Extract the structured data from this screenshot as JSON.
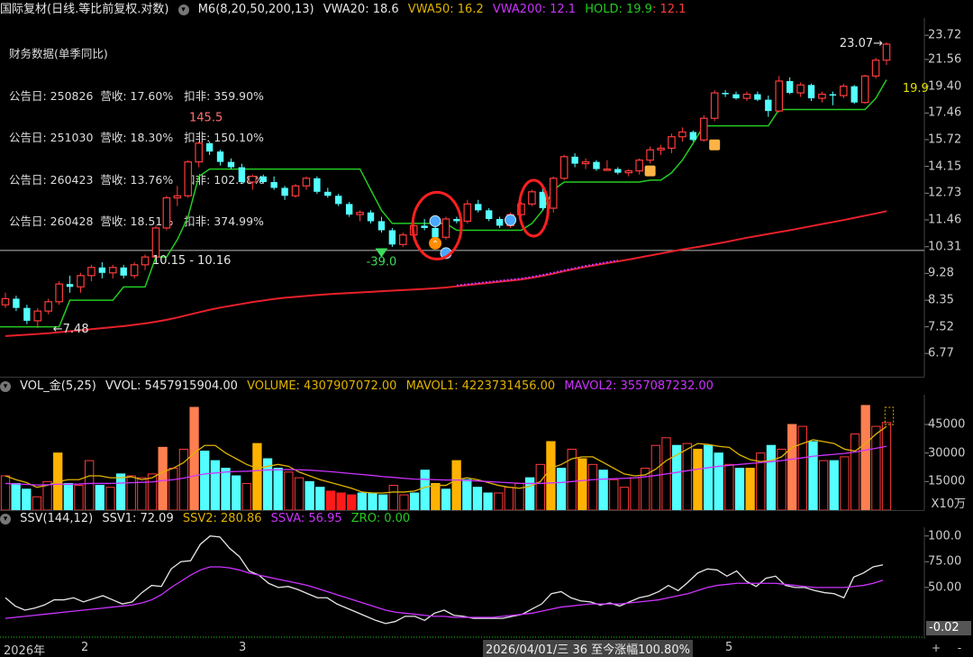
{
  "header": {
    "title": "国际复材(日线.等比前复权.对数)",
    "toggle_icon": "chevron-down-circle-icon",
    "ma_label": "M6(8,20,50,200,13)",
    "vwa20": "VWA20: 18.6",
    "vwa50": "VWA50: 16.2",
    "vwa200": "VWA200: 12.1",
    "hold1": "HOLD: 19.9",
    "hold2": ": 12.1"
  },
  "financials": {
    "title": "财务数据(单季同比)",
    "rows": [
      "公告日: 250826  营收: 17.60%   扣非: 359.90%",
      "公告日: 251030  营收: 18.30%   扣非: 150.10%",
      "公告日: 260423  营收: 13.76%   扣非: 102.98%",
      "公告日: 260428  营收: 18.51%   扣非: 374.99%"
    ]
  },
  "annotations": {
    "high": "145.5",
    "low": "7.48",
    "range": "10.15 - 10.16",
    "last_high": "23.07",
    "hold_value": "19.9",
    "signal": "-39.0"
  },
  "vol_header": {
    "name": "VOL_金(5,25)",
    "vvol": "VVOL: 5457915904.00",
    "volume": "VOLUME: 4307907072.00",
    "mavol1": "MAVOL1: 4223731456.00",
    "mavol2": "MAVOL2: 3557087232.00",
    "unit": "X10万"
  },
  "ssv_header": {
    "name": "SSV(144,12)",
    "ssv1": "SSV1: 72.09",
    "ssv2": "SSV2: 280.86",
    "ssva": "SSVA: 56.95",
    "zro": "ZRO: 0.00"
  },
  "bottom_bar": {
    "year": "2026年",
    "m2": "2",
    "m3": "3",
    "cursor_info": "2026/04/01/三 36 至今涨幅100.80%",
    "m5": "5",
    "plus": "+",
    "minus": "-"
  },
  "colors": {
    "up": "#ff3b3b",
    "down": "#54ffff",
    "hold_line": "#22cc22",
    "vwa200_line": "#e8202a",
    "mavol1": "#e0b300",
    "mavol2": "#cc33ff",
    "highlight_vol": "#ffb300",
    "accent_vol": "#ff7f50",
    "circle": "#ff2020"
  },
  "chart_data": [
    {
      "type": "candlestick",
      "title": "国际复材(日线.等比前复权.对数)",
      "scale": "log",
      "y_ticks": [
        "23.72",
        "21.56",
        "19.40",
        "17.46",
        "15.72",
        "14.15",
        "12.73",
        "11.46",
        "10.31",
        "9.28",
        "8.35",
        "7.52",
        "6.77"
      ],
      "ylim": [
        6.4,
        24.5
      ],
      "reference_line": 10.16,
      "candles": [
        [
          8.2,
          8.6,
          8.1,
          8.4
        ],
        [
          8.4,
          8.5,
          8.0,
          8.1
        ],
        [
          8.1,
          8.2,
          7.6,
          7.7
        ],
        [
          7.7,
          8.1,
          7.48,
          8.0
        ],
        [
          8.0,
          8.4,
          7.9,
          8.3
        ],
        [
          8.3,
          9.0,
          8.2,
          8.9
        ],
        [
          8.9,
          9.2,
          8.6,
          8.8
        ],
        [
          8.8,
          9.3,
          8.6,
          9.2
        ],
        [
          9.2,
          9.6,
          9.0,
          9.5
        ],
        [
          9.5,
          9.7,
          9.1,
          9.3
        ],
        [
          9.3,
          9.6,
          9.1,
          9.5
        ],
        [
          9.5,
          9.6,
          9.1,
          9.2
        ],
        [
          9.2,
          9.7,
          9.1,
          9.6
        ],
        [
          9.6,
          10.0,
          9.4,
          9.9
        ],
        [
          9.9,
          11.2,
          9.8,
          11.1
        ],
        [
          11.1,
          12.6,
          11.0,
          12.5
        ],
        [
          12.5,
          13.1,
          12.1,
          12.6
        ],
        [
          12.6,
          14.5,
          12.5,
          14.4
        ],
        [
          14.4,
          15.6,
          14.1,
          15.5
        ],
        [
          15.5,
          15.6,
          14.8,
          15.0
        ],
        [
          15.0,
          15.1,
          14.2,
          14.4
        ],
        [
          14.4,
          14.6,
          14.0,
          14.1
        ],
        [
          14.1,
          14.3,
          13.2,
          13.3
        ],
        [
          13.3,
          13.7,
          12.9,
          13.6
        ],
        [
          13.6,
          13.7,
          13.2,
          13.3
        ],
        [
          13.3,
          13.6,
          12.9,
          13.0
        ],
        [
          13.0,
          13.1,
          12.4,
          12.6
        ],
        [
          12.6,
          13.2,
          12.5,
          13.1
        ],
        [
          13.1,
          13.6,
          12.9,
          13.5
        ],
        [
          13.5,
          13.6,
          12.7,
          12.8
        ],
        [
          12.8,
          13.0,
          12.5,
          12.6
        ],
        [
          12.6,
          12.7,
          12.1,
          12.2
        ],
        [
          12.2,
          12.3,
          11.6,
          11.7
        ],
        [
          11.7,
          11.9,
          11.4,
          11.8
        ],
        [
          11.8,
          11.9,
          11.3,
          11.4
        ],
        [
          11.4,
          11.6,
          10.9,
          11.0
        ],
        [
          11.0,
          11.1,
          10.3,
          10.4
        ],
        [
          10.4,
          10.9,
          10.3,
          10.8
        ],
        [
          10.8,
          11.4,
          10.6,
          11.2
        ],
        [
          11.2,
          11.5,
          11.0,
          11.1
        ],
        [
          11.1,
          11.3,
          10.6,
          10.7
        ],
        [
          10.7,
          11.6,
          10.6,
          11.5
        ],
        [
          11.5,
          11.6,
          11.3,
          11.4
        ],
        [
          11.4,
          12.4,
          11.3,
          12.2
        ],
        [
          12.2,
          12.4,
          11.8,
          11.9
        ],
        [
          11.9,
          12.0,
          11.4,
          11.5
        ],
        [
          11.5,
          11.6,
          11.1,
          11.2
        ],
        [
          11.2,
          11.8,
          11.1,
          11.7
        ],
        [
          11.7,
          12.3,
          11.6,
          12.2
        ],
        [
          12.2,
          12.9,
          12.1,
          12.8
        ],
        [
          12.8,
          13.0,
          11.9,
          12.0
        ],
        [
          12.0,
          13.6,
          11.8,
          13.5
        ],
        [
          13.5,
          14.8,
          13.4,
          14.7
        ],
        [
          14.7,
          14.9,
          14.1,
          14.3
        ],
        [
          14.3,
          14.6,
          14.0,
          14.4
        ],
        [
          14.4,
          14.5,
          13.9,
          14.0
        ],
        [
          14.0,
          14.5,
          13.9,
          14.0
        ],
        [
          14.0,
          14.1,
          13.7,
          13.8
        ],
        [
          13.8,
          14.0,
          13.6,
          13.9
        ],
        [
          13.9,
          14.6,
          13.7,
          14.5
        ],
        [
          14.5,
          15.3,
          14.3,
          15.1
        ],
        [
          15.1,
          15.4,
          14.8,
          15.2
        ],
        [
          15.2,
          16.1,
          14.9,
          15.9
        ],
        [
          15.9,
          16.5,
          15.6,
          16.2
        ],
        [
          16.2,
          16.3,
          15.6,
          15.7
        ],
        [
          15.7,
          17.3,
          15.6,
          17.1
        ],
        [
          17.1,
          19.1,
          16.9,
          18.9
        ],
        [
          18.9,
          19.1,
          18.6,
          18.8
        ],
        [
          18.8,
          19.0,
          18.4,
          18.5
        ],
        [
          18.5,
          19.0,
          18.3,
          18.8
        ],
        [
          18.8,
          19.0,
          18.3,
          18.4
        ],
        [
          18.4,
          18.7,
          17.2,
          17.6
        ],
        [
          17.6,
          20.2,
          17.5,
          19.8
        ],
        [
          19.8,
          20.1,
          18.8,
          18.9
        ],
        [
          18.9,
          19.7,
          18.6,
          19.5
        ],
        [
          19.5,
          19.6,
          18.3,
          18.5
        ],
        [
          18.5,
          19.0,
          18.2,
          18.8
        ],
        [
          18.8,
          19.0,
          18.0,
          18.7
        ],
        [
          18.7,
          19.6,
          18.5,
          19.4
        ],
        [
          19.4,
          19.5,
          18.1,
          18.2
        ],
        [
          18.2,
          20.3,
          18.1,
          20.2
        ],
        [
          20.2,
          21.7,
          20.0,
          21.5
        ],
        [
          21.5,
          23.07,
          21.1,
          22.9
        ]
      ],
      "hold_line": [
        7.52,
        7.52,
        7.52,
        7.52,
        7.52,
        7.52,
        8.35,
        8.35,
        8.35,
        8.35,
        8.35,
        8.8,
        8.8,
        8.8,
        9.9,
        9.9,
        10.6,
        11.6,
        13.6,
        14.0,
        14.0,
        14.0,
        14.0,
        14.0,
        14.0,
        14.0,
        14.0,
        14.0,
        14.0,
        14.0,
        14.0,
        14.0,
        14.0,
        14.0,
        12.9,
        11.9,
        11.3,
        11.3,
        11.3,
        11.3,
        11.3,
        11.3,
        11.0,
        11.0,
        11.0,
        11.0,
        11.0,
        11.0,
        11.0,
        11.3,
        11.9,
        12.9,
        13.3,
        13.3,
        13.3,
        13.3,
        13.3,
        13.3,
        13.3,
        13.3,
        13.4,
        13.4,
        13.8,
        14.5,
        15.5,
        16.6,
        16.6,
        16.6,
        16.6,
        16.6,
        16.6,
        16.6,
        17.7,
        17.7,
        17.7,
        17.7,
        17.7,
        17.7,
        17.7,
        17.7,
        17.7,
        18.5,
        19.9
      ],
      "vwa200_line": [
        7.25,
        7.27,
        7.29,
        7.31,
        7.33,
        7.36,
        7.39,
        7.42,
        7.45,
        7.48,
        7.51,
        7.54,
        7.58,
        7.62,
        7.67,
        7.73,
        7.8,
        7.88,
        7.96,
        8.04,
        8.11,
        8.17,
        8.23,
        8.29,
        8.34,
        8.39,
        8.43,
        8.46,
        8.49,
        8.52,
        8.55,
        8.57,
        8.59,
        8.61,
        8.63,
        8.65,
        8.67,
        8.69,
        8.71,
        8.73,
        8.75,
        8.78,
        8.82,
        8.86,
        8.9,
        8.94,
        8.98,
        9.02,
        9.06,
        9.12,
        9.19,
        9.27,
        9.36,
        9.44,
        9.52,
        9.59,
        9.66,
        9.73,
        9.8,
        9.88,
        9.96,
        10.04,
        10.12,
        10.2,
        10.27,
        10.34,
        10.42,
        10.5,
        10.59,
        10.68,
        10.76,
        10.84,
        10.92,
        11.0,
        11.09,
        11.18,
        11.27,
        11.36,
        11.45,
        11.55,
        11.65,
        11.75,
        11.86
      ]
    },
    {
      "type": "bar",
      "title": "VOL_金(5,25)",
      "y_ticks": [
        "45000",
        "30000",
        "15000"
      ],
      "ylim": [
        0,
        54000
      ],
      "values": [
        18000,
        14000,
        11000,
        7000,
        15000,
        30000,
        14000,
        13000,
        26000,
        13000,
        12000,
        19000,
        18000,
        17000,
        19000,
        33000,
        22000,
        32000,
        54000,
        31000,
        26000,
        22000,
        18000,
        14000,
        35000,
        27000,
        22000,
        20000,
        17000,
        15000,
        12000,
        10000,
        9000,
        8000,
        9000,
        9000,
        8000,
        13000,
        8000,
        9000,
        21000,
        14000,
        11000,
        26000,
        16000,
        12000,
        9000,
        9000,
        12000,
        14000,
        17000,
        24000,
        36000,
        22000,
        32000,
        27000,
        24000,
        21000,
        16000,
        12000,
        17000,
        22000,
        34000,
        38000,
        34000,
        35000,
        32000,
        34000,
        30000,
        24000,
        22000,
        22000,
        30000,
        34000,
        32000,
        45000,
        44000,
        36000,
        26000,
        26000,
        28000,
        40000,
        55000,
        44000,
        46000
      ],
      "mavol1": [
        18000,
        16000,
        14500,
        12000,
        13000,
        15000,
        16000,
        16000,
        18000,
        18000,
        17000,
        17000,
        17500,
        16000,
        17000,
        20000,
        22000,
        25000,
        30000,
        34000,
        34000,
        30000,
        27000,
        24000,
        22000,
        23000,
        24000,
        23000,
        20000,
        18000,
        16000,
        14500,
        13000,
        11500,
        9500,
        9000,
        9000,
        9500,
        9500,
        10000,
        12000,
        13000,
        13000,
        16000,
        17000,
        16000,
        14500,
        13000,
        12000,
        11500,
        12500,
        15000,
        22000,
        24000,
        27000,
        28000,
        28000,
        25000,
        22000,
        19000,
        18000,
        18500,
        21500,
        26000,
        29000,
        32000,
        35000,
        34500,
        33500,
        33000,
        29000,
        26500,
        25500,
        26000,
        28000,
        33000,
        35000,
        37000,
        36000,
        35000,
        32000,
        31000,
        35000,
        40000,
        44000
      ],
      "mavol2": [
        14000,
        13800,
        13500,
        13200,
        13300,
        13600,
        13600,
        13700,
        14000,
        14000,
        14000,
        14200,
        14400,
        14600,
        14800,
        15500,
        16000,
        16800,
        18000,
        19000,
        19500,
        20000,
        20300,
        20400,
        20800,
        21100,
        21200,
        21300,
        21200,
        21000,
        20600,
        20200,
        19700,
        19200,
        18700,
        18200,
        17600,
        17200,
        16700,
        16300,
        16200,
        16000,
        15800,
        15800,
        15600,
        15300,
        15000,
        14700,
        14400,
        14100,
        14000,
        14000,
        14300,
        14500,
        15000,
        15500,
        16000,
        16300,
        16500,
        16700,
        17000,
        17500,
        18200,
        19000,
        19800,
        20700,
        21500,
        22300,
        23000,
        23500,
        24000,
        24500,
        25000,
        25500,
        26000,
        26800,
        27500,
        28300,
        28800,
        29300,
        29800,
        30500,
        31500,
        32500,
        33500
      ]
    },
    {
      "type": "line",
      "title": "SSV(144,12)",
      "y_ticks": [
        "100.0",
        "75.00",
        "50.00"
      ],
      "last_value_tag": "-0.02",
      "ylim": [
        0,
        105
      ],
      "series": [
        {
          "name": "SSV1",
          "values": [
            40,
            32,
            28,
            30,
            33,
            38,
            38,
            40,
            36,
            39,
            42,
            38,
            34,
            36,
            45,
            52,
            51,
            68,
            75,
            76,
            92,
            100,
            99,
            88,
            80,
            66,
            62,
            54,
            50,
            51,
            48,
            44,
            40,
            40,
            34,
            30,
            26,
            22,
            18,
            15,
            17,
            22,
            22,
            18,
            25,
            28,
            23,
            22,
            20,
            20,
            20,
            20,
            22,
            24,
            29,
            34,
            44,
            46,
            40,
            37,
            36,
            33,
            35,
            32,
            36,
            40,
            42,
            46,
            52,
            47,
            55,
            64,
            68,
            67,
            61,
            66,
            56,
            51,
            59,
            61,
            52,
            50,
            50,
            47,
            45,
            44,
            40,
            60,
            64,
            70,
            72
          ]
        },
        {
          "name": "SSVA",
          "values": [
            20,
            21,
            22,
            23,
            24,
            25,
            26,
            27,
            28,
            29,
            30,
            31,
            32,
            33,
            35,
            38,
            43,
            50,
            56,
            62,
            67,
            70,
            70,
            69,
            67,
            64,
            62,
            60,
            58,
            56,
            54,
            52,
            49,
            46,
            43,
            40,
            37,
            34,
            31,
            28,
            26,
            25,
            24,
            23,
            22,
            22,
            21,
            21,
            21,
            21,
            21,
            22,
            23,
            24,
            25,
            27,
            29,
            31,
            32,
            33,
            34,
            34,
            34,
            34,
            35,
            36,
            37,
            38,
            40,
            42,
            44,
            47,
            50,
            52,
            53,
            54,
            54,
            54,
            54,
            54,
            53,
            52,
            51,
            50,
            50,
            50,
            50,
            51,
            52,
            54,
            57
          ]
        }
      ]
    }
  ]
}
